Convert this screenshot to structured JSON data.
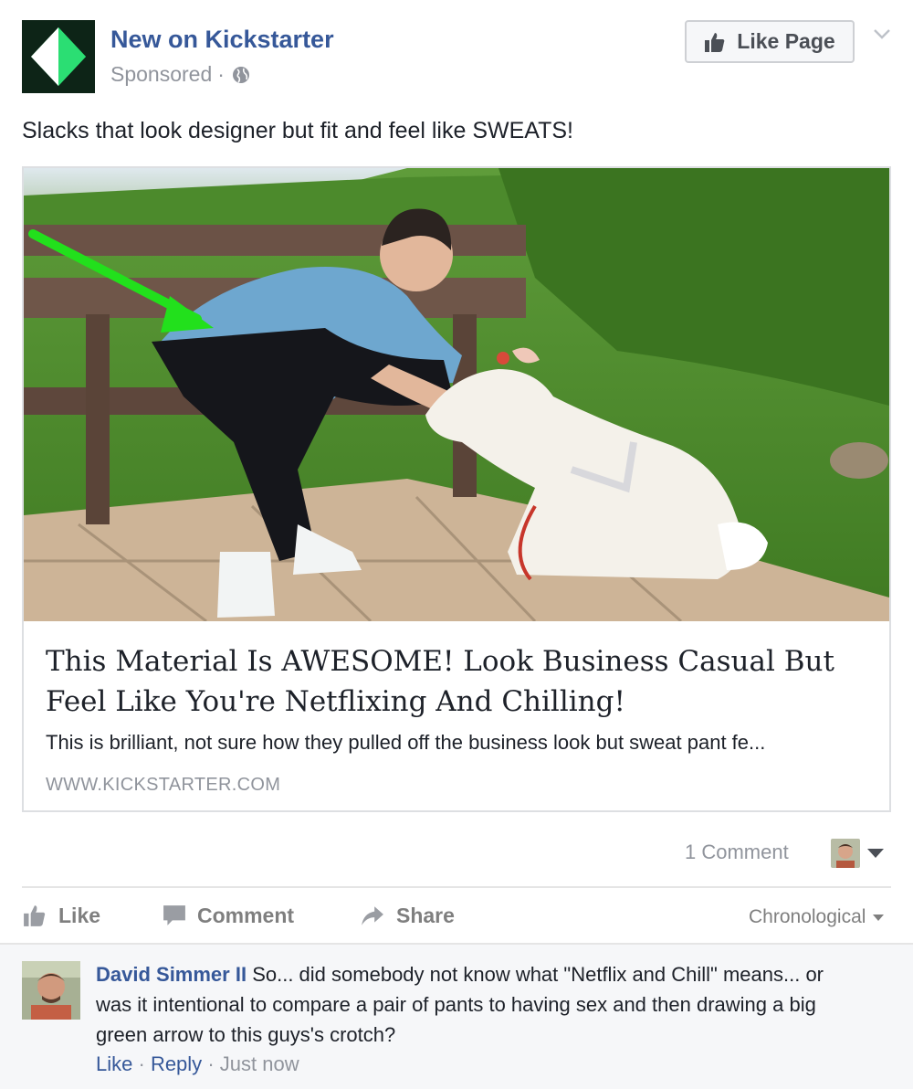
{
  "post": {
    "page_name": "New on Kickstarter",
    "sponsored_label": "Sponsored",
    "separator": "·",
    "like_page_label": "Like Page",
    "text": "Slacks that look designer but fit and feel like SWEATS!"
  },
  "link": {
    "title": "This Material Is AWESOME! Look Business Casual But Feel Like You're Netflixing And Chilling!",
    "description": "This is brilliant, not sure how they pulled off the business look but sweat pant fe...",
    "domain": "WWW.KICKSTARTER.COM"
  },
  "stats": {
    "comment_count_label": "1 Comment"
  },
  "actions": {
    "like": "Like",
    "comment": "Comment",
    "share": "Share",
    "sort": "Chronological"
  },
  "comment": {
    "author": "David Simmer II",
    "text": "So... did somebody not know what \"Netflix and Chill\" means... or was it intentional to compare a pair of pants to having sex and then drawing a big green arrow to this guys's crotch?",
    "like_label": "Like",
    "reply_label": "Reply",
    "sep": "·",
    "time": "Just now"
  },
  "colors": {
    "link_blue": "#365899",
    "meta_gray": "#90949c",
    "action_gray": "#7f7f7f",
    "logo_green": "#2bde73",
    "arrow_green": "#22e01c"
  }
}
